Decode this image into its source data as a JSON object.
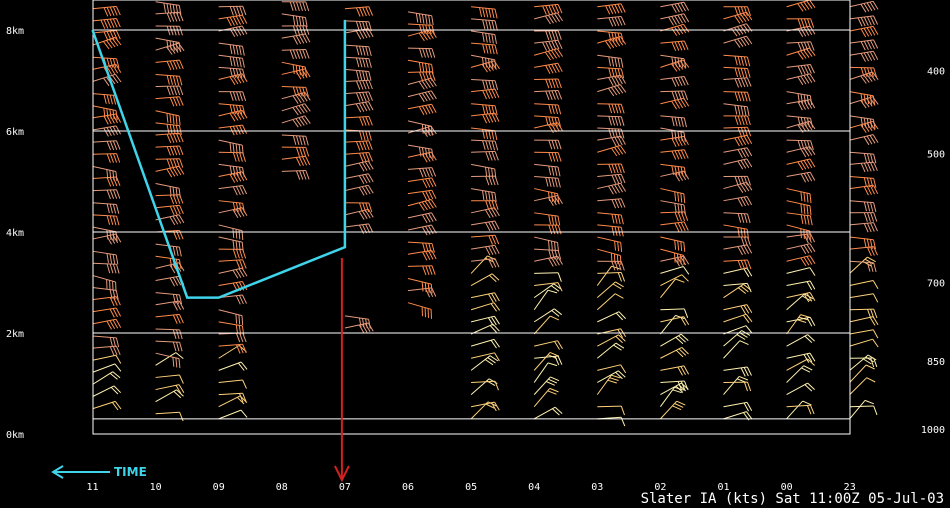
{
  "chart_data": {
    "type": "wind-profiler-time-height",
    "title": "Slater IA (kts) Sat 11:00Z 05-Jul-03",
    "time_axis": {
      "labels": [
        "11",
        "10",
        "09",
        "08",
        "07",
        "06",
        "05",
        "04",
        "03",
        "02",
        "01",
        "00",
        "23"
      ],
      "direction_label": "TIME",
      "direction": "right-to-left"
    },
    "height_axis": {
      "labels": [
        "8km",
        "6km",
        "4km",
        "2km",
        "0km"
      ],
      "values_km": [
        8,
        6,
        4,
        2,
        0
      ],
      "range_km": [
        0,
        8.4
      ]
    },
    "pressure_axis": {
      "labels": [
        "400",
        "500",
        "700",
        "850",
        "1000"
      ],
      "heights_km": [
        7.2,
        5.55,
        3.0,
        1.45,
        0.1
      ]
    },
    "reference_lines_km": [
      8,
      6,
      4,
      2,
      0.3
    ],
    "columns": [
      {
        "time": "11",
        "levels": [
          0.5,
          8.6
        ]
      },
      {
        "time": "10",
        "levels": [
          0.4,
          8.6
        ]
      },
      {
        "time": "09",
        "levels": [
          0.3,
          8.6
        ]
      },
      {
        "time": "08",
        "levels": [
          5.2,
          8.6
        ]
      },
      {
        "time": "07",
        "levels": [
          4.1,
          8.6
        ],
        "extra_levels": [
          2.1,
          2.4
        ]
      },
      {
        "time": "06",
        "levels": [
          2.6,
          8.6
        ]
      },
      {
        "time": "05",
        "levels": [
          0.3,
          8.6
        ]
      },
      {
        "time": "04",
        "levels": [
          0.3,
          8.6
        ]
      },
      {
        "time": "03",
        "levels": [
          0.3,
          8.6
        ]
      },
      {
        "time": "02",
        "levels": [
          0.3,
          8.6
        ]
      },
      {
        "time": "01",
        "levels": [
          0.3,
          8.6
        ]
      },
      {
        "time": "00",
        "levels": [
          0.3,
          8.6
        ]
      },
      {
        "time": "23",
        "levels": [
          0.3,
          8.6
        ]
      }
    ],
    "annotation_line": {
      "color": "#3fd4ea",
      "points": [
        {
          "time": 11,
          "km": 8.0
        },
        {
          "time": 9.5,
          "km": 2.7
        },
        {
          "time": 9.0,
          "km": 2.7
        },
        {
          "time": 7.0,
          "km": 3.7
        },
        {
          "time": 7.0,
          "km": 8.2
        }
      ]
    },
    "marker_arrow": {
      "time": "07",
      "color": "#d42020"
    },
    "barb_colors": [
      "#e59a7c",
      "#ff8a4a",
      "#ffd17a",
      "#fff2b0"
    ]
  }
}
